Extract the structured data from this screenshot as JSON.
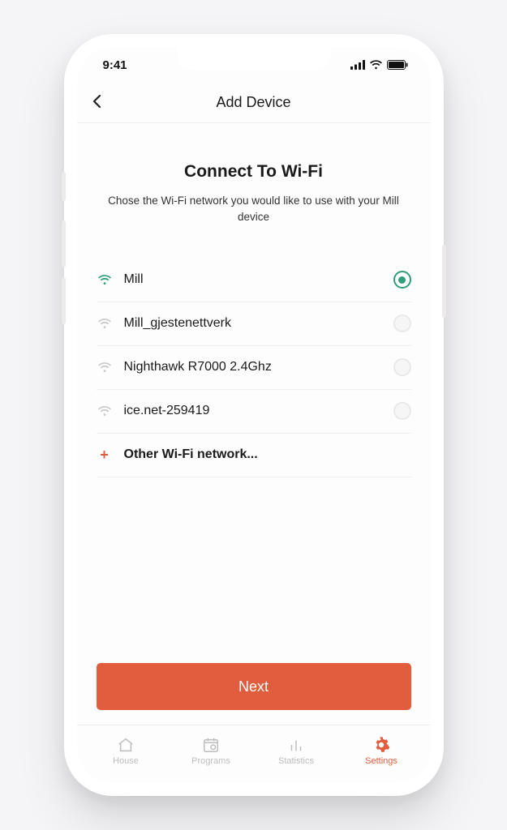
{
  "status": {
    "time": "9:41"
  },
  "header": {
    "title": "Add Device"
  },
  "main": {
    "title": "Connect To Wi-Fi",
    "subtitle": "Chose the Wi-Fi network you would like   to use with your Mill device"
  },
  "networks": [
    {
      "name": "Mill",
      "selected": true
    },
    {
      "name": "Mill_gjestenettverk",
      "selected": false
    },
    {
      "name": "Nighthawk R7000 2.4Ghz",
      "selected": false
    },
    {
      "name": "ice.net-259419",
      "selected": false
    }
  ],
  "other_network_label": "Other Wi-Fi network...",
  "next_button": "Next",
  "tabs": [
    {
      "label": "House"
    },
    {
      "label": "Programs"
    },
    {
      "label": "Statistics"
    },
    {
      "label": "Settings"
    }
  ],
  "colors": {
    "accent": "#e25c3e",
    "selected": "#2f9e7a"
  }
}
